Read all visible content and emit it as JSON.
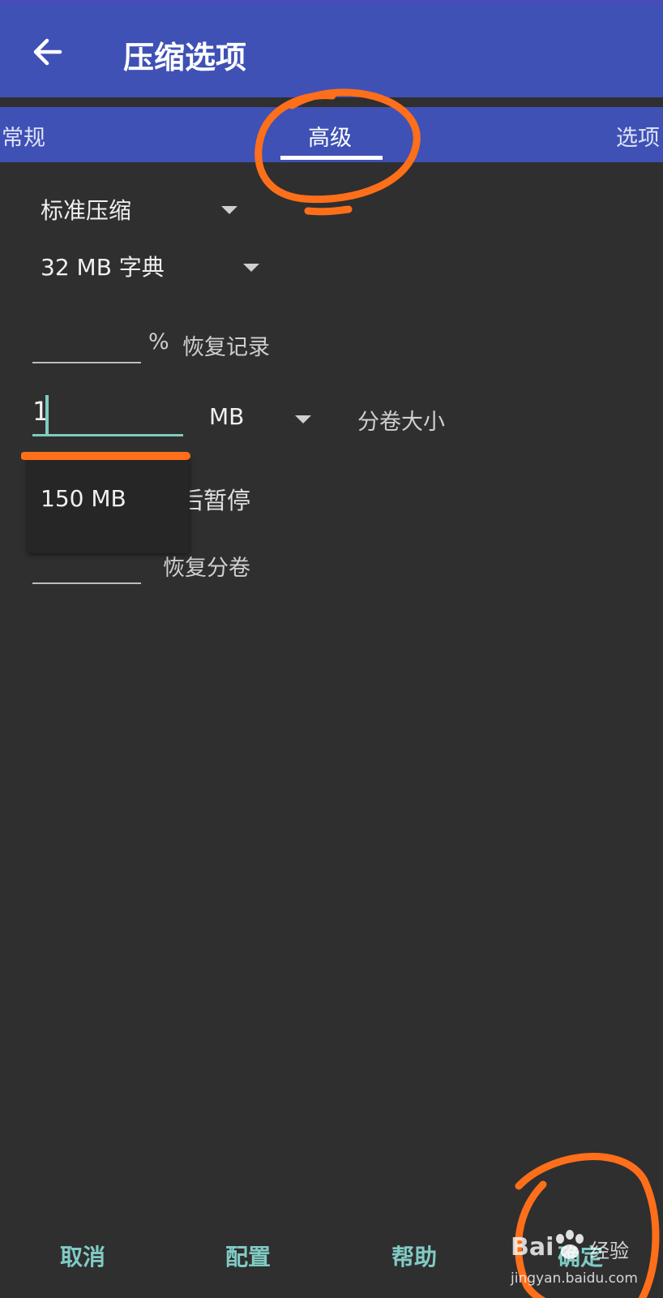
{
  "appbar": {
    "title": "压缩选项",
    "back_icon": "arrow-left-icon"
  },
  "tabs": [
    {
      "label": "常规",
      "active": false
    },
    {
      "label": "高级",
      "active": true
    },
    {
      "label": "选项",
      "active": false
    }
  ],
  "settings": {
    "compression_method": "标准压缩",
    "dictionary_size": "32 MB 字典",
    "recovery_record_unit": "%",
    "recovery_record_label": "恢复记录",
    "volume_size_value": "1",
    "volume_size_unit": "MB",
    "volume_size_label": "分卷大小",
    "pause_label_partial": "后暂停",
    "recovery_volumes_label": "恢复分卷"
  },
  "dropdown_popup": {
    "options": [
      "150 MB"
    ]
  },
  "footer": {
    "cancel": "取消",
    "profiles": "配置",
    "help": "帮助",
    "ok": "确定"
  },
  "watermark": {
    "logo_text": "Bai",
    "brand_text": "经验",
    "url": "jingyan.baidu.com"
  },
  "colors": {
    "primary": "#3f51b5",
    "background": "#2f2f2f",
    "accent": "#80cbc4",
    "annotation": "#ff6f1a"
  }
}
